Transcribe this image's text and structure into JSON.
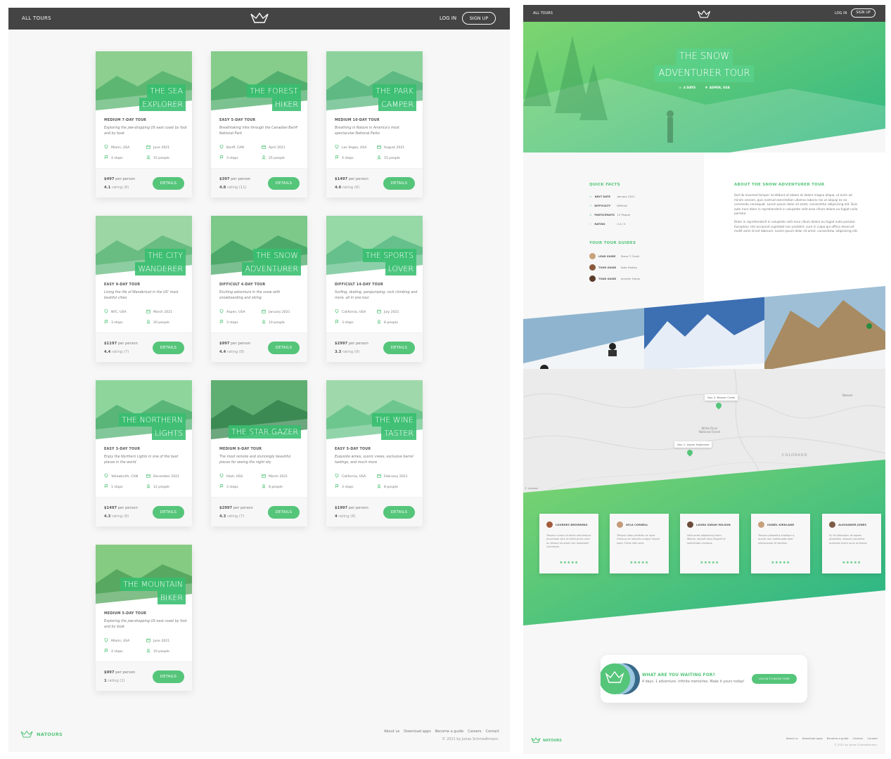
{
  "overview": {
    "header": {
      "nav_left": "ALL TOURS",
      "login": "LOG IN",
      "signup": "SIGN UP"
    },
    "cards": [
      {
        "name1": "THE SEA",
        "name2": "EXPLORER",
        "difficulty": "MEDIUM 7-DAY TOUR",
        "summary": "Exploring the jaw-dropping US east coast by foot and by boat",
        "location": "Miami, USA",
        "date": "June 2021",
        "stops": "4 stops",
        "people": "15 people",
        "price": "$497",
        "per": "per person",
        "rating": "4.1",
        "ratings_label": "rating (8)",
        "button": "DETAILS"
      },
      {
        "name1": "THE FOREST",
        "name2": "HIKER",
        "difficulty": "EASY 5-DAY TOUR",
        "summary": "Breathtaking hike through the Canadian Banff National Park",
        "location": "Banff, CAN",
        "date": "April 2021",
        "stops": "3 stops",
        "people": "25 people",
        "price": "$397",
        "per": "per person",
        "rating": "4.8",
        "ratings_label": "rating (11)",
        "button": "DETAILS"
      },
      {
        "name1": "THE PARK",
        "name2": "CAMPER",
        "difficulty": "MEDIUM 10-DAY TOUR",
        "summary": "Breathing in Nature in America's most spectacular National Parks",
        "location": "Las Vegas, USA",
        "date": "August 2021",
        "stops": "4 stops",
        "people": "15 people",
        "price": "$1497",
        "per": "per person",
        "rating": "4.6",
        "ratings_label": "rating (8)",
        "button": "DETAILS"
      },
      {
        "name1": "THE CITY",
        "name2": "WANDERER",
        "difficulty": "EASY 9-DAY TOUR",
        "summary": "Living the life of Wanderlust in the US' most beatiful cities",
        "location": "NYC, USA",
        "date": "March 2021",
        "stops": "3 stops",
        "people": "20 people",
        "price": "$1197",
        "per": "per person",
        "rating": "4.4",
        "ratings_label": "rating (7)",
        "button": "DETAILS"
      },
      {
        "name1": "THE SNOW",
        "name2": "ADVENTURER",
        "difficulty": "DIFFICULT 4-DAY TOUR",
        "summary": "Exciting adventure in the snow with snowboarding and skiing",
        "location": "Aspen, USA",
        "date": "January 2021",
        "stops": "3 stops",
        "people": "10 people",
        "price": "$997",
        "per": "per person",
        "rating": "4.4",
        "ratings_label": "rating (8)",
        "button": "DETAILS"
      },
      {
        "name1": "THE SPORTS",
        "name2": "LOVER",
        "difficulty": "DIFFICULT 14-DAY TOUR",
        "summary": "Surfing, skating, parajumping, rock climbing and more, all in one tour",
        "location": "California, USA",
        "date": "July 2021",
        "stops": "3 stops",
        "people": "8 people",
        "price": "$2997",
        "per": "per person",
        "rating": "3.3",
        "ratings_label": "rating (9)",
        "button": "DETAILS"
      },
      {
        "name1": "THE NORTHERN",
        "name2": "LIGHTS",
        "difficulty": "EASY 3-DAY TOUR",
        "summary": "Enjoy the Northern Lights in one of the best places in the world",
        "location": "Yellowknife, CAN",
        "date": "December 2021",
        "stops": "1 stops",
        "people": "12 people",
        "price": "$1497",
        "per": "per person",
        "rating": "4.3",
        "ratings_label": "rating (8)",
        "button": "DETAILS"
      },
      {
        "name1": "",
        "name2": "THE STAR GAZER",
        "difficulty": "MEDIUM 9-DAY TOUR",
        "summary": "The most remote and stunningly beautiful places for seeing the night sky",
        "location": "Utah, USA",
        "date": "March 2021",
        "stops": "3 stops",
        "people": "8 people",
        "price": "$2997",
        "per": "per person",
        "rating": "4.3",
        "ratings_label": "rating (7)",
        "button": "DETAILS"
      },
      {
        "name1": "THE WINE",
        "name2": "TASTER",
        "difficulty": "EASY 5-DAY TOUR",
        "summary": "Exquisite wines, scenic views, exclusive barrel tastings, and much more",
        "location": "California, USA",
        "date": "February 2021",
        "stops": "3 stops",
        "people": "8 people",
        "price": "$1997",
        "per": "per person",
        "rating": "4",
        "ratings_label": "rating (6)",
        "button": "DETAILS"
      },
      {
        "name1": "THE MOUNTAIN",
        "name2": "BIKER",
        "difficulty": "MEDIUM 5-DAY TOUR",
        "summary": "Exploring the jaw-dropping US east coast by foot and by boat",
        "location": "Miami, USA",
        "date": "June 2021",
        "stops": "4 stops",
        "people": "10 people",
        "price": "$997",
        "per": "per person",
        "rating": "1",
        "ratings_label": "rating (1)",
        "button": "DETAILS"
      }
    ],
    "footer": {
      "brand": "NATOURS",
      "links": [
        "About us",
        "Download apps",
        "Become a guide",
        "Careers",
        "Contact"
      ],
      "copy": "© 2021 by Jonas Schmedtmann."
    }
  },
  "detail": {
    "header": {
      "nav_left": "ALL TOURS",
      "login": "LOG IN",
      "signup": "SIGN UP"
    },
    "title1": "THE SNOW",
    "title2": "ADVENTURER TOUR",
    "duration": "4 DAYS",
    "location": "ASPEN, USA",
    "facts_heading": "QUICK FACTS",
    "facts": [
      {
        "label": "NEXT DATE",
        "value": "January 2021"
      },
      {
        "label": "DIFFICULTY",
        "value": "Difficult"
      },
      {
        "label": "PARTICIPANTS",
        "value": "10 People"
      },
      {
        "label": "RATING",
        "value": "4.4 / 5"
      }
    ],
    "guides_heading": "YOUR TOUR GUIDES",
    "guides": [
      {
        "role": "LEAD GUIDE",
        "name": "Steve T. Scott"
      },
      {
        "role": "TOUR GUIDE",
        "name": "Kate Hodley"
      },
      {
        "role": "TOUR GUIDE",
        "name": "Jennifer Hardy"
      }
    ],
    "about_heading": "ABOUT THE SNOW ADVENTURER TOUR",
    "about_p1": "Sed do eiusmod tempor incididunt ut labore et dolore magna aliqua, ut enim ad minim veniam, quis nostrud exercitation ullamco laboris nisi ut aliquip ex ea commodo consequat. Lorem ipsum dolor sit amet, consectetur adipisicing elit. Duis aute irure dolor in reprehenderit in voluptate velit esse cillum dolore eu fugiat nulla pariatur.",
    "about_p2": "Dolor in reprehenderit in voluptate velit esse cillum dolore eu fugiat nulla pariatur. Excepteur sint occaecat cupidatat non proident, sunt in culpa qui officia deserunt mollit anim id est laborum. Lorem ipsum dolor sit amet, consectetur adipisicing elit.",
    "map": {
      "popup1": "Day 1: Aspen Highlands",
      "popup2": "Day 2: Beaver Creek",
      "label_state": "COLORADO",
      "label_forest": "White River National Forest",
      "label_city": "Denver",
      "attribution": "© mapbox"
    },
    "reviews": [
      {
        "name": "LOURDES BROWNING",
        "text": "Tempor cursus id tellus sed tempor accumsan sed. Id amet proin urna ac dictum sit amet non imperdiet commodo.",
        "stars": "★★★★★"
      },
      {
        "name": "AYLA CORNELL",
        "text": "Tempor diam porttitor ac eget rhoncus ac lobortis congue neque justo. Porta nibh sem.",
        "stars": "★★★★★"
      },
      {
        "name": "LAURA SARAH WILSON",
        "text": "Velit amet adipisicing enim. Mauris, aliquet risus feugiat id sollicitudin vivamus.",
        "stars": "★★★★★"
      },
      {
        "name": "ISABEL KIRKLAND",
        "text": "Tempor phasellus tristique a, auctor non malesuada eget ullamcorper et facilisis.",
        "stars": "★★★★★"
      },
      {
        "name": "ALEXANDER JONES",
        "text": "Eu et bibendum at sapien phasellus, aliquam pharetra euismod lorem nunc id fames.",
        "stars": "★★★★★"
      }
    ],
    "cta": {
      "question": "WHAT ARE YOU WAITING FOR?",
      "subtitle": "4 days. 1 adventure. Infinite memories. Make it yours today!",
      "button": "LOG IN TO BOOK TOUR"
    },
    "footer": {
      "brand": "NATOURS",
      "links": [
        "About us",
        "Download apps",
        "Become a guide",
        "Careers",
        "Contact"
      ],
      "copy": "© 2021 by Jonas Schmedtmann."
    }
  },
  "colors": {
    "primary": "#55c57a",
    "dark": "#444444",
    "light_bg": "#f7f7f7"
  }
}
